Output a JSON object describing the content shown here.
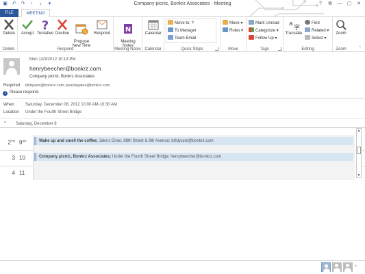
{
  "window": {
    "title": "Company picnic, Bonkrz Associates - Meeting",
    "controls": [
      "?",
      "⧉",
      "—",
      "▢",
      "✕"
    ]
  },
  "tabs": {
    "file": "FILE",
    "meeting": "MEETING"
  },
  "ribbon": {
    "delete": {
      "label": "Delete",
      "group": "Delete"
    },
    "respond": {
      "accept": "Accept",
      "tentative": "Tentative",
      "decline": "Decline",
      "propose": "Propose\nNew Time",
      "respond": "Respond",
      "group": "Respond"
    },
    "meeting_notes": {
      "label": "Meeting\nNotes",
      "group": "Meeting Notes"
    },
    "calendar": {
      "label": "Calendar",
      "group": "Calendar"
    },
    "quick_steps": {
      "items": [
        "Move to: ?",
        "To Manager",
        "Team Email"
      ],
      "group": "Quick Steps"
    },
    "move": {
      "move": "Move",
      "rules": "Rules",
      "group": "Move"
    },
    "tags": {
      "mark_unread": "Mark Unread",
      "categorize": "Categorize",
      "follow_up": "Follow Up",
      "group": "Tags"
    },
    "editing": {
      "translate": "Translate",
      "find": "Find",
      "related": "Related",
      "select": "Select",
      "group": "Editing"
    },
    "zoom": {
      "label": "Zoom",
      "group": "Zoom"
    }
  },
  "message": {
    "date": "Mon 12/3/2012 10:13 PM",
    "sender": "henrybeecher@bonkrz.com",
    "subject": "Company picnic, Bonkrz Associates",
    "required_label": "Required",
    "required": "billdyszel@bonkrz.com; pearliegates@bonkrz.com",
    "info": "Please respond.",
    "when_label": "When",
    "when": "Saturday, December 08, 2012 10:00 AM-10:30 AM",
    "location_label": "Location",
    "location": "Under the Fourth Street Bridge"
  },
  "calendar": {
    "day_header": "Saturday, December 8",
    "rows": [
      {
        "left": "2",
        "left_sup": "PM",
        "right": "9",
        "right_sup": "AM"
      },
      {
        "left": "3",
        "left_sup": "",
        "right": "10",
        "right_sup": ""
      },
      {
        "left": "4",
        "left_sup": "",
        "right": "11",
        "right_sup": ""
      }
    ],
    "appointments": [
      {
        "title": "Wake up and smell the coffee;",
        "detail": "Jake's Diner, 88th Street & 8th Avenue; billdyszel@bonkrz.com"
      },
      {
        "title": "Company picnic, Bonkrz Associates;",
        "detail": "Under the Fourth Street Bridge; henrybeecher@bonkrz.com"
      }
    ]
  },
  "colors": {
    "accent": "#2b579a",
    "appointment": "#d7e4f2",
    "appointment_border": "#98b7da"
  },
  "icons": {
    "qat": [
      "save-icon",
      "undo-icon",
      "redo-icon",
      "up-arrow-icon",
      "down-arrow-icon",
      "customize-icon"
    ],
    "people": [
      "person-icon",
      "person-icon",
      "person-icon"
    ]
  }
}
